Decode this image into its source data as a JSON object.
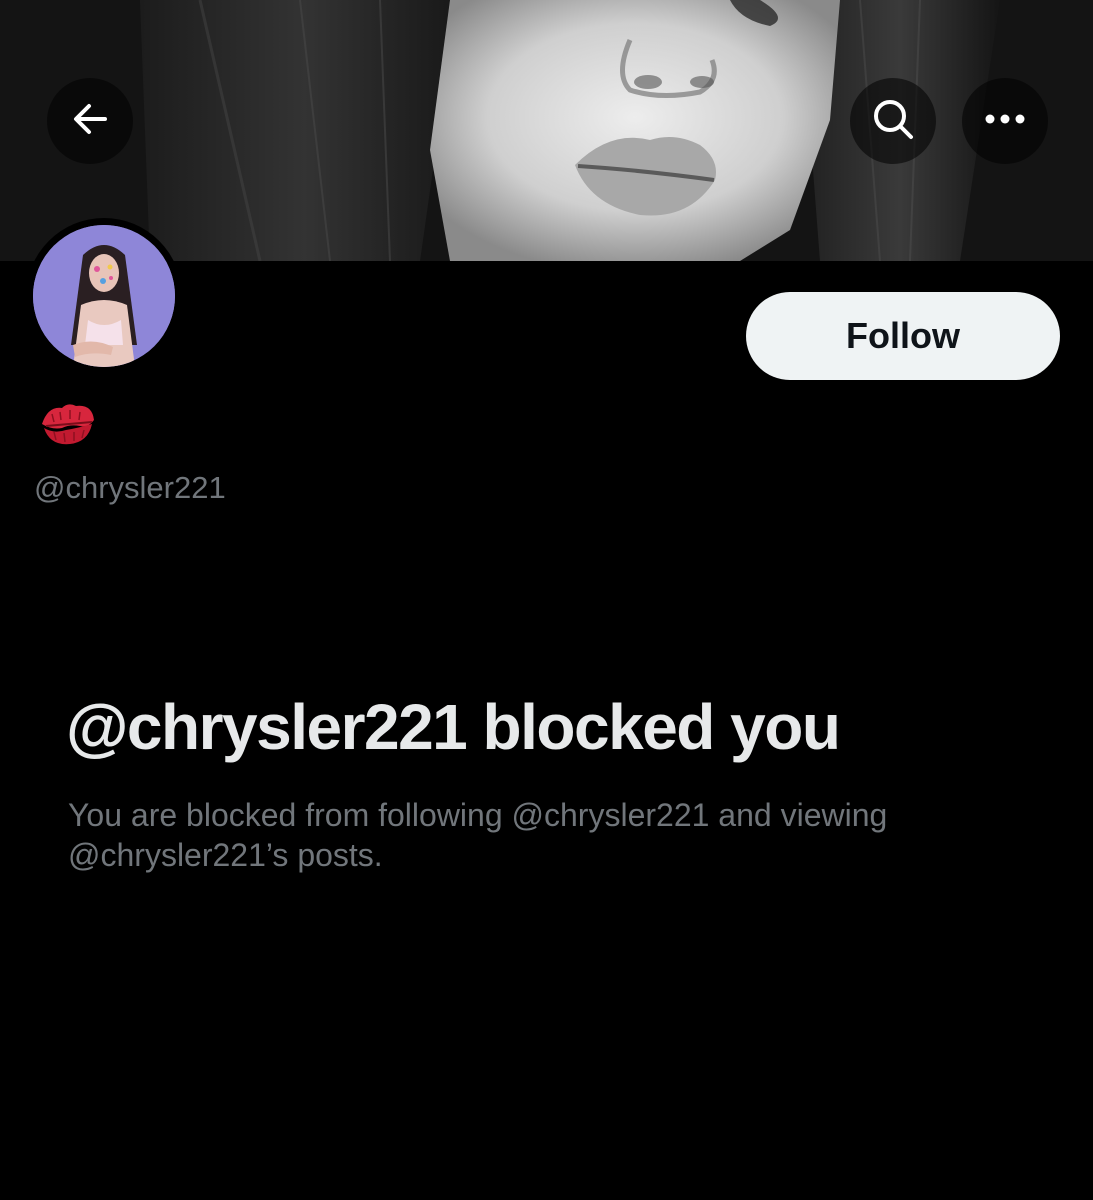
{
  "header": {
    "back_icon": "arrow-left-icon",
    "search_icon": "search-icon",
    "more_icon": "more-horizontal-icon"
  },
  "profile": {
    "display_name_emoji": "💋",
    "handle": "@chrysler221",
    "follow_label": "Follow"
  },
  "blocked": {
    "title": "@chrysler221 blocked you",
    "description": "You are blocked from following @chrysler221 and viewing @chrysler221’s posts."
  },
  "colors": {
    "background": "#000000",
    "primary_text": "#e7e9ea",
    "secondary_text": "#71767b",
    "follow_button_bg": "#eff3f4",
    "follow_button_text": "#0f1419",
    "avatar_bg": "#8e86d8"
  }
}
